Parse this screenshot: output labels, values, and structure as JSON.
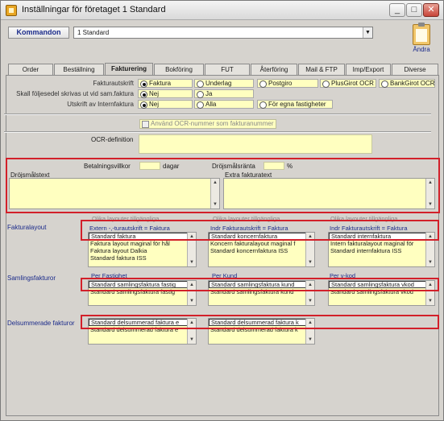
{
  "window": {
    "title": "Inställningar för företaget 1 Standard",
    "buttons": {
      "minimize": "_",
      "maximize": "□",
      "close": "✕"
    }
  },
  "toolbar": {
    "command_label": "Kommandon",
    "company_value": "1  Standard",
    "andra_label": "Ändra",
    "andra_icon": "clipboard-icon"
  },
  "tabs": [
    {
      "label": "Order"
    },
    {
      "label": "Beställning"
    },
    {
      "label": "Fakturering"
    },
    {
      "label": "Bokföring"
    },
    {
      "label": "FUT"
    },
    {
      "label": "Återföring"
    },
    {
      "label": "Mail & FTP"
    },
    {
      "label": "Imp/Export"
    },
    {
      "label": "Diverse"
    }
  ],
  "fakturautskrift": {
    "label": "Fakturautskrift",
    "options": [
      "Faktura",
      "Underlag",
      "Postgiro",
      "PlusGirot OCR",
      "BankGirot OCR"
    ],
    "selected": "Faktura"
  },
  "foljesedel": {
    "label": "Skall följesedel skrivas ut vid sam.faktura",
    "options": [
      "Nej",
      "Ja"
    ],
    "selected": "Nej"
  },
  "internfaktura": {
    "label": "Utskrift av Internfaktura",
    "options": [
      "Nej",
      "Alla",
      "För egna fastigheter"
    ],
    "selected": "Nej"
  },
  "ocr_checkbox_label": "Använd OCR-nummer som fakturanummer",
  "ocr_definition_label": "OCR-definition",
  "betalningsvillkor": {
    "label": "Betalningsvillkor",
    "unit": "dagar"
  },
  "drojsmalsranta": {
    "label": "Dröjsmålsränta",
    "unit": "%"
  },
  "drojsmalstext_label": "Dröjsmålstext",
  "extra_fakturatext_label": "Extra fakturatext",
  "fakturalayout": {
    "label": "Fakturalayout",
    "columns": [
      {
        "header_top": "Olika layouter tillgängliga",
        "header": "Extern  -,-turautskrift = Faktura",
        "items": [
          "Standard faktura",
          "Faktura layout maginal för hål",
          "Faktura layout Dalkia",
          "Standard faktura ISS"
        ]
      },
      {
        "header_top": "Olika layouter tillgängliga",
        "header": "Indr Fakturautskrift = Faktura",
        "items": [
          "Standard koncernfaktura",
          "Koncern fakturalayout maginal f",
          "Standard koncernfaktura ISS"
        ]
      },
      {
        "header_top": "Olika layouter tillgängliga",
        "header": "Indr Fakturautskrift = Faktura",
        "items": [
          "Standard internfaktura",
          "Intern fakturalayout maginal för",
          "Standard internfaktura ISS"
        ]
      }
    ]
  },
  "samlingsfakturor": {
    "label": "Samlingsfakturor",
    "columns": [
      {
        "header": "Per Fastighet",
        "items": [
          "Standard samlingsfaktura fastig",
          "Standard samlingsfaktura fastig"
        ]
      },
      {
        "header": "Per Kund",
        "items": [
          "Standard samlingsfaktura kund",
          "Standard samlingsfaktura kund"
        ]
      },
      {
        "header": "Per v-kod",
        "items": [
          "Standard samlingsfaktura vkod",
          "Standard samlingsfaktura vkod"
        ]
      }
    ]
  },
  "delsummerade": {
    "label": "Delsummerade fakturor",
    "columns": [
      {
        "items": [
          "Standard delsummerad faktura e",
          "Standard delsummerad faktura e"
        ]
      },
      {
        "items": [
          "Standard delsummerad faktura k",
          "Standard delsummerad faktura k"
        ]
      }
    ]
  }
}
